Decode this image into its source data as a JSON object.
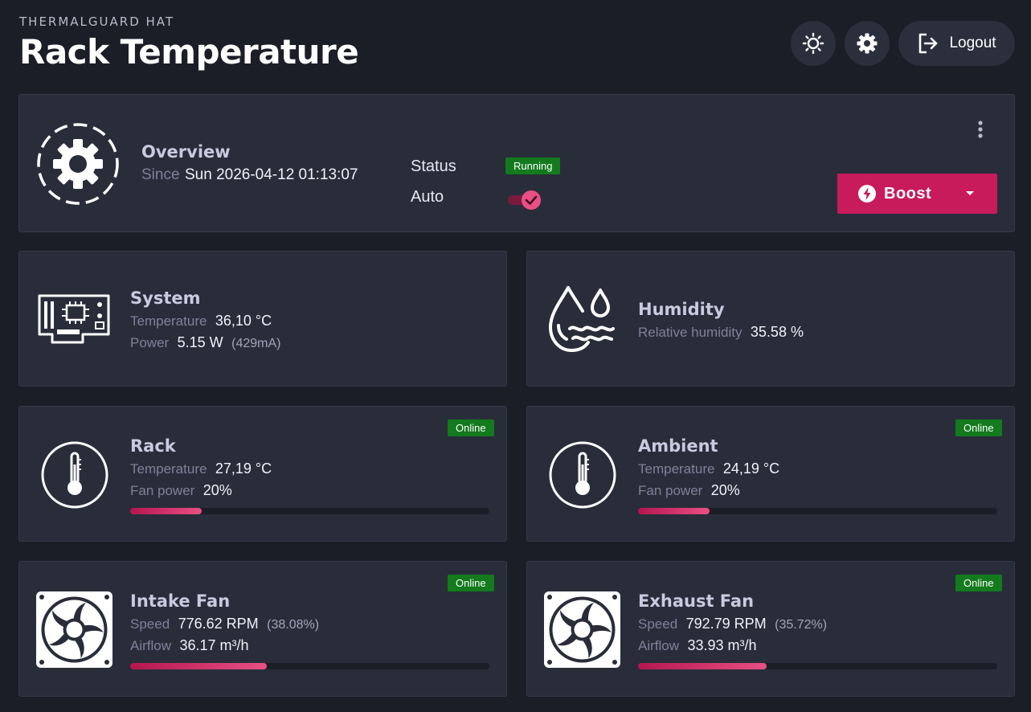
{
  "header": {
    "brand": "THERMALGUARD HAT",
    "title": "Rack Temperature",
    "logout_label": "Logout"
  },
  "overview": {
    "title": "Overview",
    "since_label": "Since",
    "since_value": "Sun 2026-04-12 01:13:07",
    "status_label": "Status",
    "status_value": "Running",
    "auto_label": "Auto",
    "auto_enabled": true,
    "boost_label": "Boost"
  },
  "system": {
    "title": "System",
    "temp_label": "Temperature",
    "temp_value": "36,10 °C",
    "power_label": "Power",
    "power_value": "5.15 W",
    "power_sub": "(429mA)"
  },
  "humidity": {
    "title": "Humidity",
    "rh_label": "Relative humidity",
    "rh_value": "35.58 %"
  },
  "rack": {
    "title": "Rack",
    "badge": "Online",
    "temp_label": "Temperature",
    "temp_value": "27,19 °C",
    "fan_label": "Fan power",
    "fan_value": "20%",
    "fan_fraction": 0.2
  },
  "ambient": {
    "title": "Ambient",
    "badge": "Online",
    "temp_label": "Temperature",
    "temp_value": "24,19 °C",
    "fan_label": "Fan power",
    "fan_value": "20%",
    "fan_fraction": 0.2
  },
  "intake": {
    "title": "Intake Fan",
    "badge": "Online",
    "speed_label": "Speed",
    "speed_value": "776.62 RPM",
    "speed_sub": "(38.08%)",
    "airflow_label": "Airflow",
    "airflow_value": "36.17 m³/h",
    "fraction": 0.3808
  },
  "exhaust": {
    "title": "Exhaust Fan",
    "badge": "Online",
    "speed_label": "Speed",
    "speed_value": "792.79 RPM",
    "speed_sub": "(35.72%)",
    "airflow_label": "Airflow",
    "airflow_value": "33.93 m³/h",
    "fraction": 0.3572
  },
  "colors": {
    "accent": "#c81b5b",
    "online": "#137a1d",
    "background": "#1b1e27",
    "card": "#292d3a"
  }
}
